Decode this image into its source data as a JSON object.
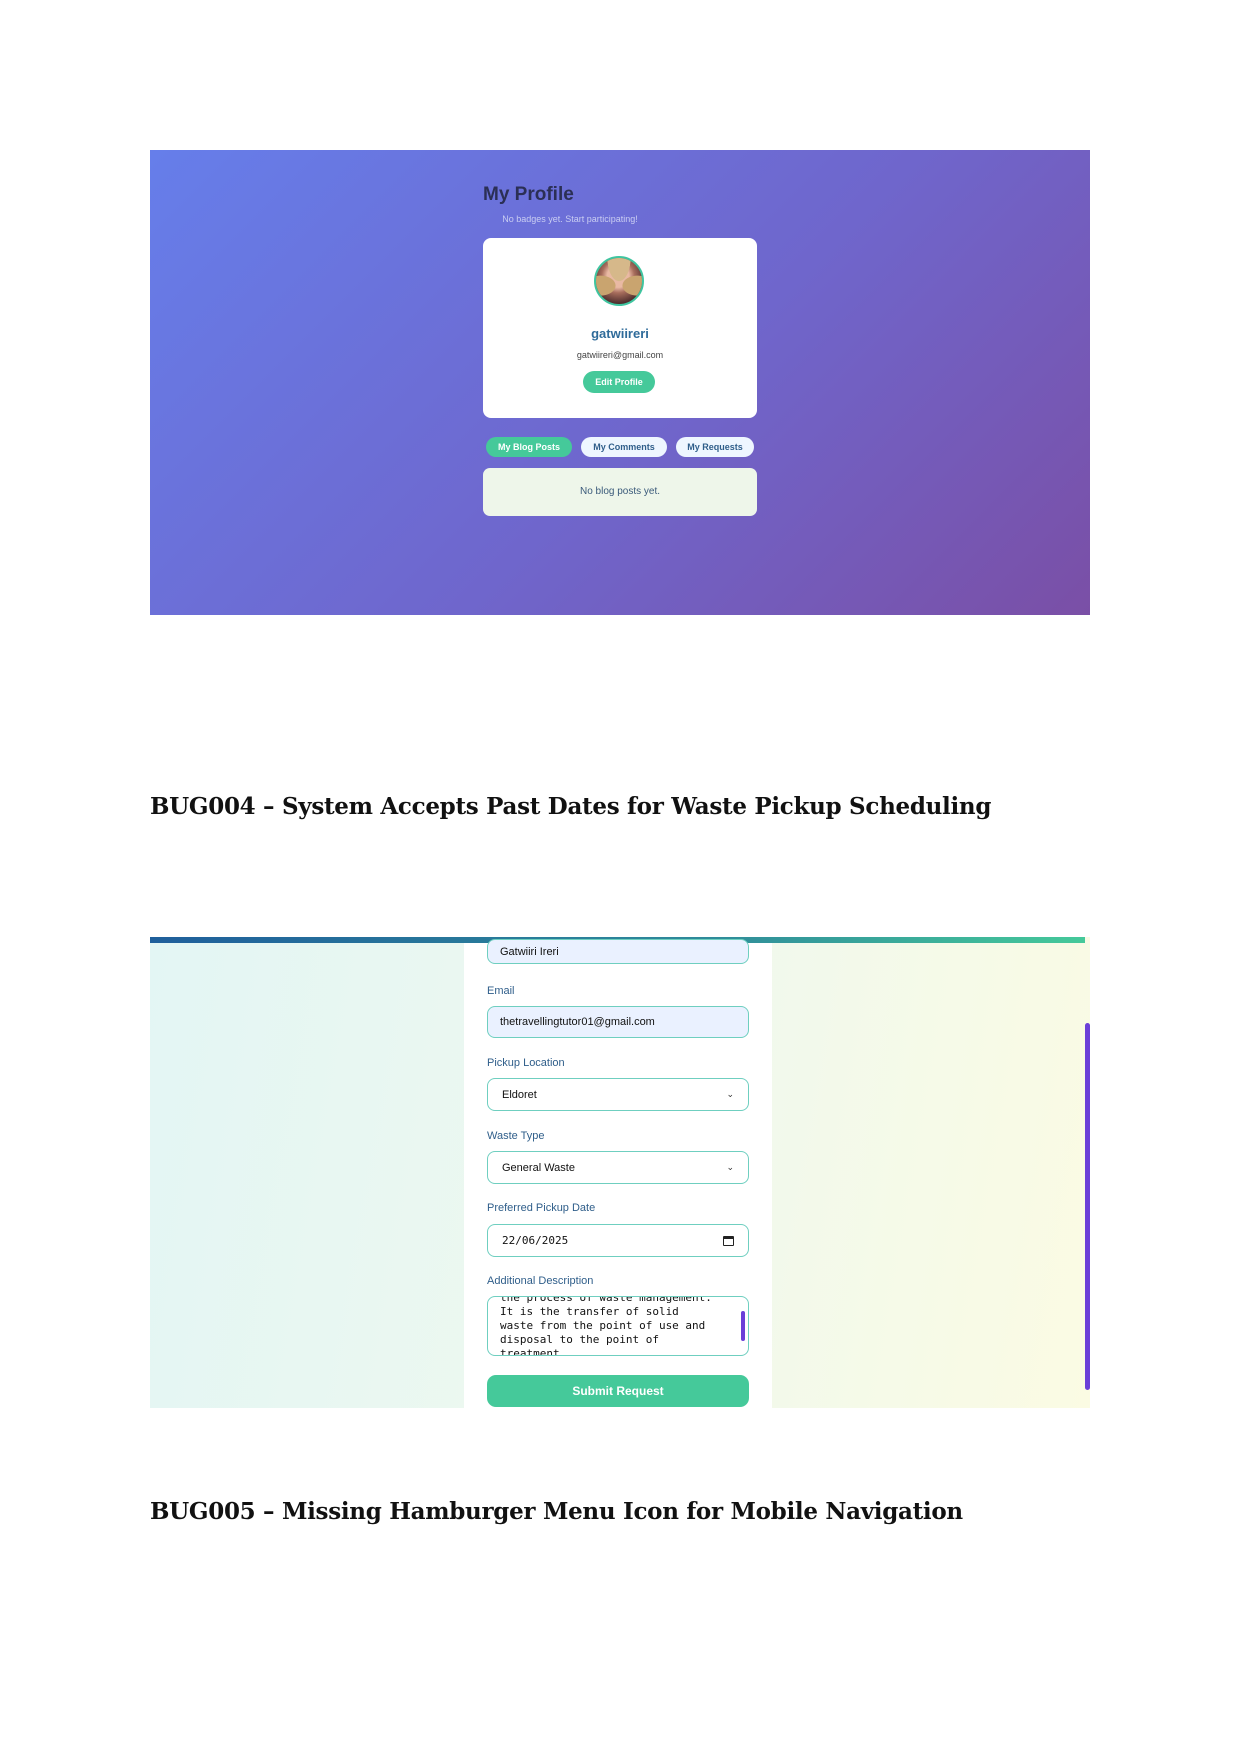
{
  "profile_screenshot": {
    "title": "My Profile",
    "badges_note": "No badges yet. Start participating!",
    "username": "gatwiireri",
    "email": "gatwiireri@gmail.com",
    "edit_button": "Edit Profile",
    "tabs": [
      "My Blog Posts",
      "My Comments",
      "My Requests"
    ],
    "empty_message": "No blog posts yet.",
    "colors": {
      "accent": "#45c99a",
      "gradient_start": "#667eea",
      "gradient_end": "#7a4fa6",
      "username": "#2f6b9a"
    }
  },
  "headings": {
    "bug004": "BUG004 – System Accepts Past Dates for Waste Pickup Scheduling",
    "bug005": "BUG005 – Missing Hamburger Menu Icon for Mobile Navigation"
  },
  "pickup_form_screenshot": {
    "name_value": "Gatwiiri Ireri",
    "email_label": "Email",
    "email_value": "thetravellingtutor01@gmail.com",
    "location_label": "Pickup Location",
    "location_value": "Eldoret",
    "waste_type_label": "Waste Type",
    "waste_type_value": "General Waste",
    "date_label": "Preferred Pickup Date",
    "date_value": "22/06/2025",
    "description_label": "Additional Description",
    "description_value": "the process of waste management.\nIt is the transfer of solid\nwaste from the point of use and\ndisposal to the point of\ntreatment",
    "submit_button": "Submit Request",
    "colors": {
      "accent": "#45c99a",
      "label": "#2f5e8a",
      "scrollbar": "#6b3fd8"
    }
  }
}
